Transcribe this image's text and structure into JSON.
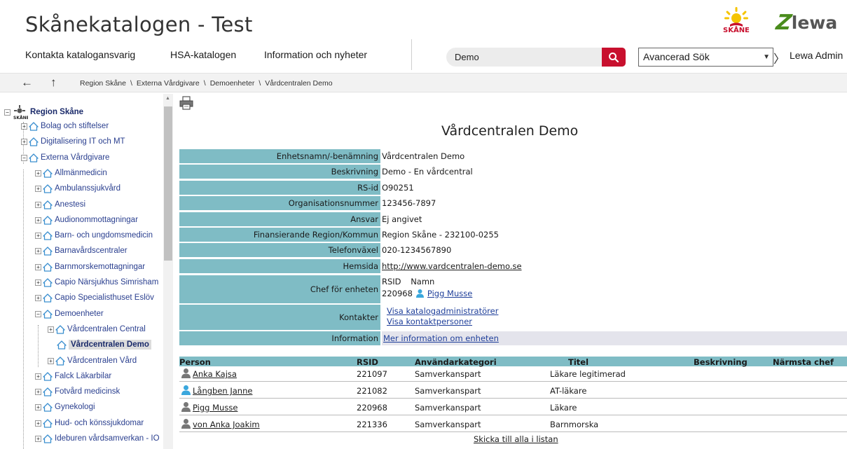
{
  "header": {
    "title": "Skånekatalogen - Test",
    "logo_skane_text": "SKÅNE",
    "logo_lewa_z": "Z",
    "logo_lewa_text": "lewa"
  },
  "nav": {
    "items": [
      {
        "label": "Kontakta katalogansvarig"
      },
      {
        "label": "HSA-katalogen"
      },
      {
        "label": "Information och nyheter"
      }
    ]
  },
  "search": {
    "value": "Demo",
    "advanced_label": "Avancerad Sök",
    "user": "Lewa Admin"
  },
  "breadcrumb": [
    "Region Skåne",
    "Externa Vårdgivare",
    "Demoenheter",
    "Vårdcentralen Demo"
  ],
  "tree": {
    "root": "Region Skåne",
    "level1": [
      "Bolag och stiftelser",
      "Digitalisering IT och MT",
      "Externa Vårdgivare"
    ],
    "level2": [
      "Allmänmedicin",
      "Ambulanssjukvård",
      "Anestesi",
      "Audionommottagningar",
      "Barn- och ungdomsmedicin",
      "Barnavårdscentraler",
      "Barnmorskemottagningar",
      "Capio Närsjukhus Simrisham",
      "Capio Specialisthuset Eslöv",
      "Demoenheter"
    ],
    "level3": [
      "Vårdcentralen Central",
      "Vårdcentralen Demo",
      "Vårdcentralen Vård"
    ],
    "level2_after": [
      "Falck Läkarbilar",
      "Fotvård medicinsk",
      "Gynekologi",
      "Hud- och könssjukdomar",
      "Ideburen vårdsamverkan - IO"
    ]
  },
  "unit": {
    "title": "Vårdcentralen Demo",
    "rows": [
      {
        "label": "Enhetsnamn/-benämning",
        "value": "Vårdcentralen Demo"
      },
      {
        "label": "Beskrivning",
        "value": "Demo - En vårdcentral"
      },
      {
        "label": "RS-id",
        "value": "O90251"
      },
      {
        "label": "Organisationsnummer",
        "value": "123456-7897"
      },
      {
        "label": "Ansvar",
        "value": "Ej angivet"
      },
      {
        "label": "Finansierande Region/Kommun",
        "value": "Region Skåne - 232100-0255"
      },
      {
        "label": "Telefonväxel",
        "value": "020-1234567890"
      },
      {
        "label": "Hemsida",
        "value": "http://www.vardcentralen-demo.se"
      }
    ],
    "chef": {
      "label": "Chef för enheten",
      "col_rsid": "RSID",
      "col_name": "Namn",
      "rsid": "220968",
      "name": "Pigg Musse"
    },
    "kontakter": {
      "label": "Kontakter",
      "link1": "Visa katalogadministratörer",
      "link2": "Visa kontaktpersoner"
    },
    "information": {
      "label": "Information",
      "link": "Mer information om enheten"
    }
  },
  "persons": {
    "columns": [
      "Person",
      "RSID",
      "Användarkategori",
      "Titel",
      "Beskrivning",
      "Närmsta chef"
    ],
    "rows": [
      {
        "name": "Anka Kajsa",
        "rsid": "221097",
        "category": "Samverkanspart",
        "title": "Läkare legitimerad",
        "icon": "person-gray-icon"
      },
      {
        "name": "Långben Janne",
        "rsid": "221082",
        "category": "Samverkanspart",
        "title": "AT-läkare",
        "icon": "person-blue-icon"
      },
      {
        "name": "Pigg Musse",
        "rsid": "220968",
        "category": "Samverkanspart",
        "title": "Läkare",
        "icon": "person-gray-icon"
      },
      {
        "name": "von Anka Joakim",
        "rsid": "221336",
        "category": "Samverkanspart",
        "title": "Barnmorska",
        "icon": "person-gray-icon"
      }
    ],
    "send_all": "Skicka till alla i listan"
  },
  "colors": {
    "label_bg": "#7fbcc5",
    "search_btn": "#c8102e",
    "tree_link": "#2a3f8f",
    "link": "#1f3f9a"
  }
}
